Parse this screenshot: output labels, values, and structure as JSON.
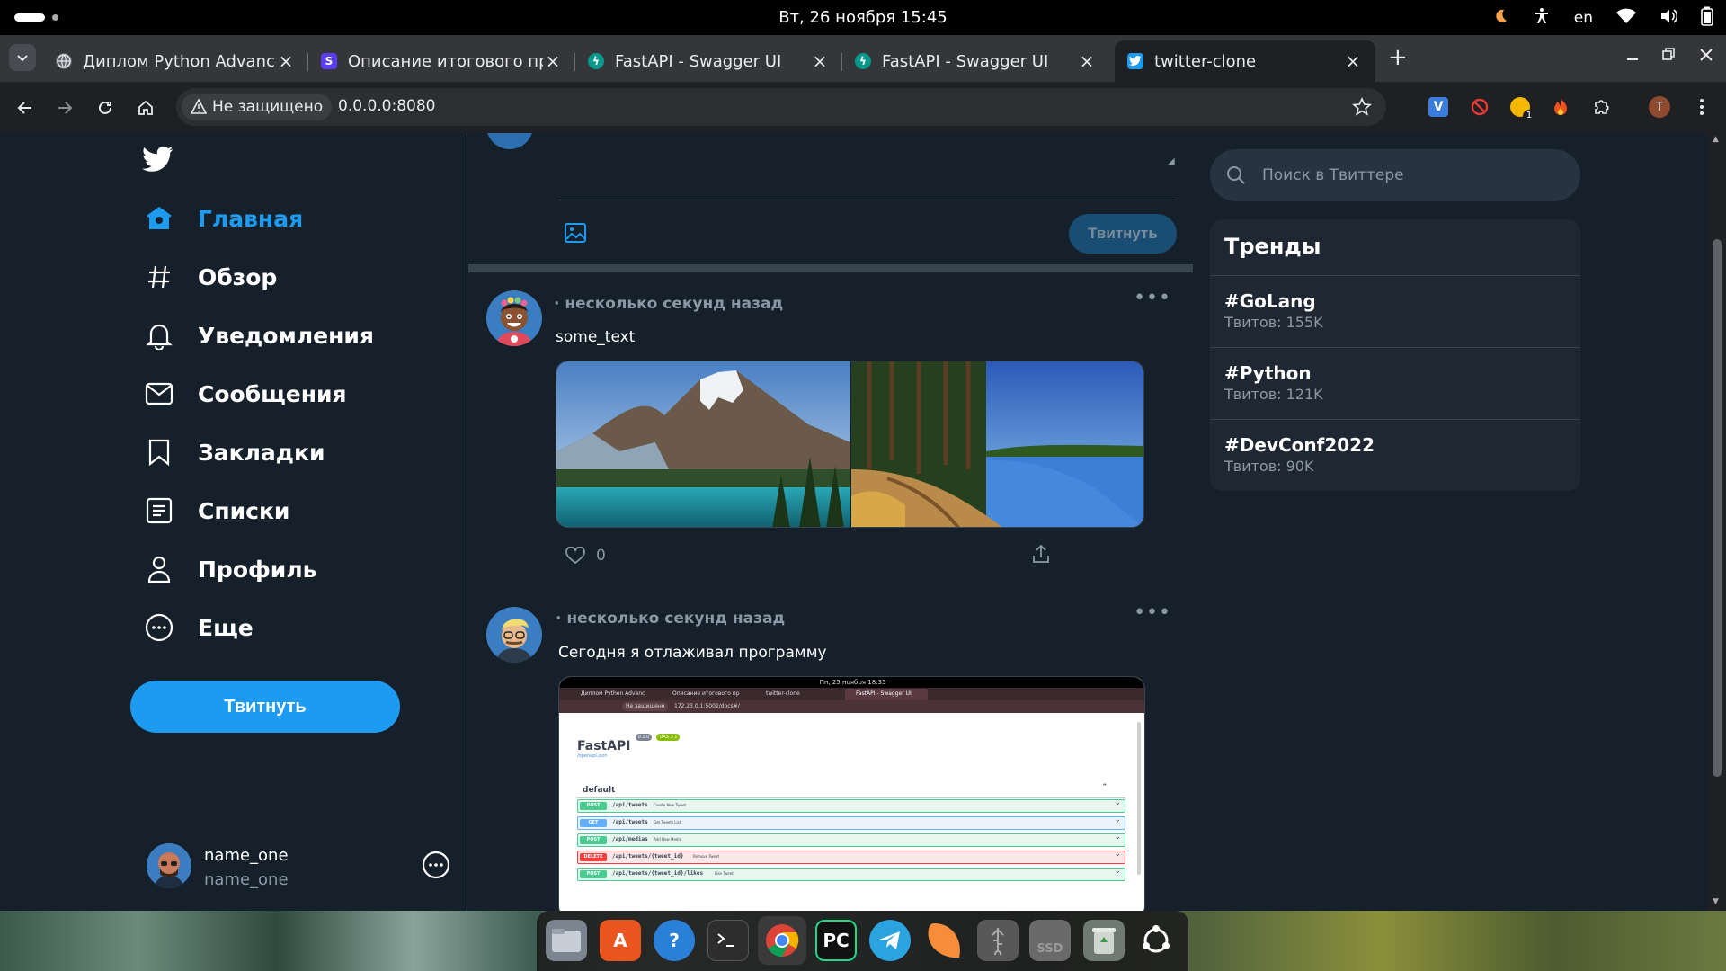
{
  "system": {
    "clock": "Вт, 26 ноября  15:45",
    "lang": "en"
  },
  "browser": {
    "tabs": [
      {
        "title": "Диплом Python Advance",
        "favicon": "globe-icon"
      },
      {
        "title": "Описание итогового пр",
        "favicon": "skillbox-icon"
      },
      {
        "title": "FastAPI - Swagger UI",
        "favicon": "fastapi-icon"
      },
      {
        "title": "FastAPI - Swagger UI",
        "favicon": "fastapi-icon"
      },
      {
        "title": "twitter-clone",
        "favicon": "twitter-icon"
      }
    ],
    "security_label": "Не защищено",
    "url": "0.0.0.0:8080",
    "extension_badge": "1",
    "profile_initial": "T"
  },
  "sidebar": {
    "items": [
      {
        "label": "Главная",
        "icon": "home-icon"
      },
      {
        "label": "Обзор",
        "icon": "hash-icon"
      },
      {
        "label": "Уведомления",
        "icon": "bell-icon"
      },
      {
        "label": "Сообщения",
        "icon": "mail-icon"
      },
      {
        "label": "Закладки",
        "icon": "bookmark-icon"
      },
      {
        "label": "Списки",
        "icon": "list-icon"
      },
      {
        "label": "Профиль",
        "icon": "user-icon"
      },
      {
        "label": "Еще",
        "icon": "more-icon"
      }
    ],
    "tweet_button": "Твитнуть",
    "account": {
      "name": "name_one",
      "handle": "name_one"
    }
  },
  "compose": {
    "tweet_button": "Твитнуть"
  },
  "feed": {
    "posts": [
      {
        "time": "· несколько секунд назад",
        "text": "some_text",
        "likes": "0"
      },
      {
        "time": "· несколько секунд назад",
        "text": "Сегодня я отлаживал программу",
        "screenshot": {
          "clock": "Пн, 25 ноября  18:35",
          "security": "Не защищено",
          "url": "172.23.0.1:5002/docs#/",
          "tabs": [
            "Диплом Python Advanc",
            "Описание итогового пр",
            "twitter-clone",
            "FastAPI - Swagger UI"
          ],
          "title": "FastAPI",
          "badge_version": "0.1.0",
          "badge_oas": "OAS 3.1",
          "link": "/openapi.json",
          "section": "default",
          "endpoints": [
            {
              "method": "POST",
              "path": "/api/tweets",
              "summary": "Create New Tweet"
            },
            {
              "method": "GET",
              "path": "/api/tweets",
              "summary": "Get Tweets List"
            },
            {
              "method": "POST",
              "path": "/api/medias",
              "summary": "Add New Media"
            },
            {
              "method": "DELETE",
              "path": "/api/tweets/{tweet_id}",
              "summary": "Remove Tweet"
            },
            {
              "method": "POST",
              "path": "/api/tweets/{tweet_id}/likes",
              "summary": "Like Tweet"
            }
          ]
        }
      }
    ]
  },
  "right": {
    "search_placeholder": "Поиск в Твиттере",
    "trends_title": "Тренды",
    "trends": [
      {
        "tag": "#GoLang",
        "count": "Твитов: 155K"
      },
      {
        "tag": "#Python",
        "count": "Твитов: 121K"
      },
      {
        "tag": "#DevConf2022",
        "count": "Твитов: 90K"
      }
    ]
  },
  "dock": {
    "apps": [
      "files-icon",
      "app-center-icon",
      "help-icon",
      "terminal-icon",
      "chrome-icon",
      "pycharm-icon",
      "telegram-icon",
      "mango-icon",
      "usb-drive-icon",
      "ssd-drive-icon",
      "trash-icon",
      "show-apps-icon"
    ],
    "ssd_label": "SSD"
  },
  "colors": {
    "accent": "#1d9bf0",
    "page_bg": "#15202b",
    "muted": "#8b98a5",
    "border": "#38444d"
  }
}
